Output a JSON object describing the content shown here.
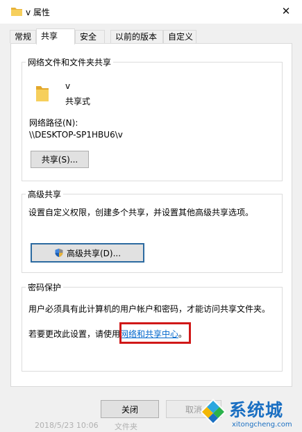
{
  "window": {
    "title": "v 属性",
    "close_symbol": "✕"
  },
  "tabs": [
    {
      "label": "常规",
      "active": false
    },
    {
      "label": "共享",
      "active": true
    },
    {
      "label": "安全",
      "active": false
    },
    {
      "label": "以前的版本",
      "active": false
    },
    {
      "label": "自定义",
      "active": false
    }
  ],
  "network_share": {
    "group_title": "网络文件和文件夹共享",
    "folder_name": "v",
    "folder_status": "共享式",
    "path_label": "网络路径(N):",
    "path_value": "\\\\DESKTOP-SP1HBU6\\v",
    "share_button": "共享(S)..."
  },
  "advanced_share": {
    "group_title": "高级共享",
    "description": "设置自定义权限，创建多个共享，并设置其他高级共享选项。",
    "button": "高级共享(D)..."
  },
  "password_protection": {
    "group_title": "密码保护",
    "description": "用户必须具有此计算机的用户帐户和密码，才能访问共享文件夹。",
    "change_prefix": "若要更改此设置，请使用",
    "link_text": "网络和共享中心",
    "change_suffix": "。"
  },
  "footer": {
    "close_button": "关闭",
    "cancel_button": "取消"
  },
  "background_text": {
    "date": "2018/5/23 10:06",
    "type": "文件夹"
  },
  "watermark": {
    "brand": "系统城",
    "domain": "xitongcheng.com"
  },
  "colors": {
    "link": "#0066cc",
    "highlight_box": "#d01818",
    "folder": "#f4c542",
    "watermark": "#1a6fc2",
    "focus_border": "#2c6aa0"
  }
}
